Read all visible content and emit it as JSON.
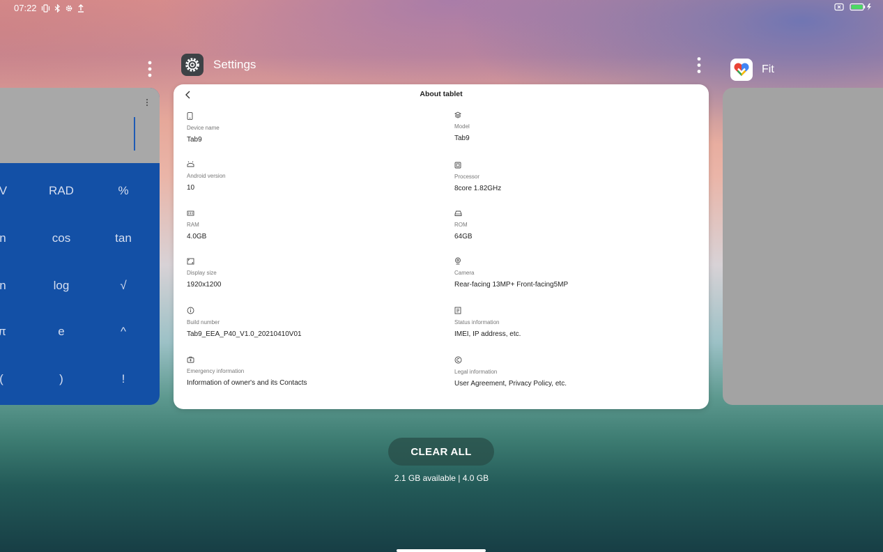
{
  "status_bar": {
    "time": "07:22"
  },
  "recents": {
    "calculator": {
      "keys": [
        "IV",
        "RAD",
        "%",
        "n",
        "cos",
        "tan",
        "n",
        "log",
        "√",
        "π",
        "e",
        "^",
        "(",
        ")",
        "!"
      ]
    },
    "settings": {
      "app_name": "Settings",
      "screen_title": "About tablet",
      "items": [
        {
          "label": "Device name",
          "value": "Tab9",
          "icon": "phone-icon"
        },
        {
          "label": "Model",
          "value": "Tab9",
          "icon": "layers-icon"
        },
        {
          "label": "Android version",
          "value": "10",
          "icon": "android-icon"
        },
        {
          "label": "Processor",
          "value": "8core 1.82GHz",
          "icon": "chip-icon"
        },
        {
          "label": "RAM",
          "value": "4.0GB",
          "icon": "memory-icon"
        },
        {
          "label": "ROM",
          "value": "64GB",
          "icon": "storage-icon"
        },
        {
          "label": "Display size",
          "value": "1920x1200",
          "icon": "display-icon"
        },
        {
          "label": "Camera",
          "value": "Rear-facing 13MP+ Front-facing5MP",
          "icon": "camera-icon"
        },
        {
          "label": "Build number",
          "value": "Tab9_EEA_P40_V1.0_20210410V01",
          "icon": "info-icon"
        },
        {
          "label": "Status information",
          "value": "IMEI, IP address, etc.",
          "icon": "status-icon"
        },
        {
          "label": "Emergency information",
          "value": "Information of owner's and its Contacts",
          "icon": "emergency-icon"
        },
        {
          "label": "Legal information",
          "value": "User Agreement, Privacy Policy, etc.",
          "icon": "copyright-icon"
        }
      ]
    },
    "fit": {
      "app_name": "Fit"
    }
  },
  "clear_all_label": "CLEAR ALL",
  "memory_text": "2.1 GB available | 4.0 GB"
}
